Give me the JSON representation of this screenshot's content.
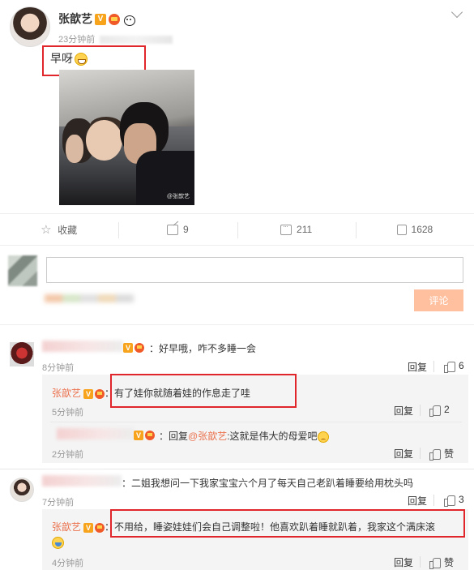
{
  "post": {
    "username": "张歆艺",
    "time": "23分钟前",
    "text": "早呀",
    "photo_watermark": "@张歆艺"
  },
  "actions": {
    "favorite": "收藏",
    "share_count": "9",
    "comment_count": "211",
    "like_count": "1628"
  },
  "composer": {
    "submit_label": "评论"
  },
  "comments": [
    {
      "text": "：好早哦，咋不多睡一会",
      "time": "8分钟前",
      "reply_label": "回复",
      "likes": "6",
      "replies": [
        {
          "name": "张歆艺",
          "text": "：有了娃你就随着娃的作息走了哇",
          "time": "5分钟前",
          "reply_label": "回复",
          "likes": "2"
        },
        {
          "prefix": "：回复",
          "mention": "@张歆艺",
          "text": ":这就是伟大的母爱吧",
          "time": "2分钟前",
          "reply_label": "回复",
          "likes": "赞"
        }
      ]
    },
    {
      "text": "：二姐我想问一下我家宝宝六个月了每天自己老趴着睡要给用枕头吗",
      "time": "7分钟前",
      "reply_label": "回复",
      "likes": "3",
      "replies": [
        {
          "name": "张歆艺",
          "text": "：不用给，睡姿娃娃们会自己调整啦！他喜欢趴着睡就趴着，我家这个满床滚",
          "time": "4分钟前",
          "reply_label": "回复",
          "likes": "赞"
        }
      ]
    }
  ],
  "colors": {
    "accent": "#eb7350",
    "highlight_box": "#e0262a",
    "button_disabled": "#ffc09f"
  }
}
